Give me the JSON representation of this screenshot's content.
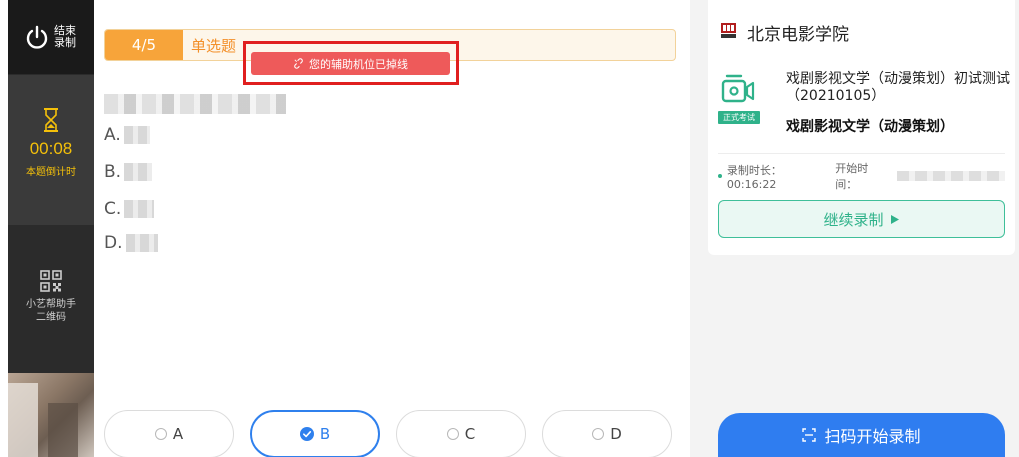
{
  "sidebar": {
    "end_label": "结束录制",
    "timer_value": "00:08",
    "timer_label": "本题倒计时",
    "qr_label_1": "小艺帮助手",
    "qr_label_2": "二维码"
  },
  "question": {
    "progress": "4/5",
    "type": "单选题",
    "alert": "您的辅助机位已掉线",
    "options": [
      "A.",
      "B.",
      "C.",
      "D."
    ]
  },
  "answers": [
    {
      "label": "A",
      "selected": false
    },
    {
      "label": "B",
      "selected": true
    },
    {
      "label": "C",
      "selected": false
    },
    {
      "label": "D",
      "selected": false
    }
  ],
  "panel": {
    "school": "北京电影学院",
    "exam_title": "戏剧影视文学（动漫策划）初试测试（20210105）",
    "exam_badge": "正式考试",
    "exam_subject": "戏剧影视文学（动漫策划）",
    "record_text": "录制时长：00:16:22",
    "start_time_label": "开始时间：",
    "continue_label": "继续录制",
    "scan_label": "扫码开始录制"
  },
  "colors": {
    "accent_blue": "#2f7df0",
    "accent_green": "#2fb28a",
    "orange": "#f7a43a",
    "alert_red": "#ee5a5a",
    "timer_yellow": "#f4c00a"
  }
}
